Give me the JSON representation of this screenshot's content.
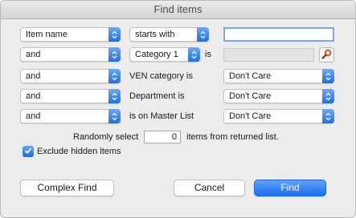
{
  "window": {
    "title": "Find items"
  },
  "rows": [
    {
      "field": "Item name",
      "operator": "starts with",
      "search_value": ""
    },
    {
      "join": "and",
      "category": "Category 1",
      "is_label": "is"
    },
    {
      "join": "and",
      "label": "VEN category is",
      "value": "Don't Care"
    },
    {
      "join": "and",
      "label": "Department is",
      "value": "Don't Care"
    },
    {
      "join": "and",
      "label": "is on Master List",
      "value": "Don't Care"
    }
  ],
  "random": {
    "prefix": "Randomly select",
    "count": "0",
    "suffix": "items from returned list."
  },
  "exclude_hidden": {
    "label": "Exclude hidden items",
    "checked": true
  },
  "buttons": {
    "complex_find": "Complex Find",
    "cancel": "Cancel",
    "find": "Find"
  },
  "colors": {
    "accent": "#1b6cf0",
    "window_bg": "#ececec"
  }
}
